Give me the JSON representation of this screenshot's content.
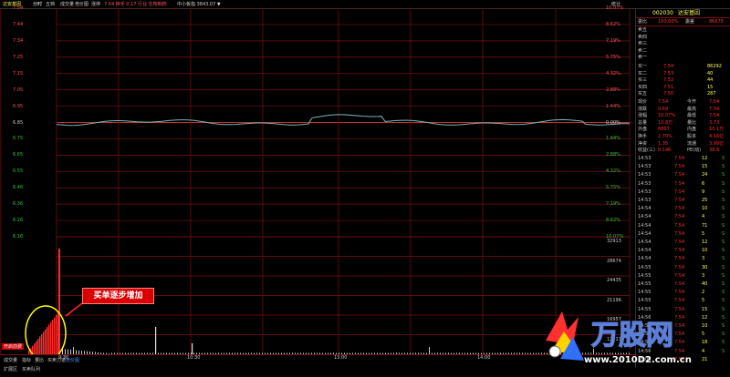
{
  "topbar": {
    "left_title": "达安基因",
    "tabs": [
      "分时",
      "五档",
      "成交量",
      "竞价图",
      "涨停"
    ],
    "status": "7.54 换手 0.17 行业 生物制药",
    "index_info": "中小板指 3843.07 ▼",
    "right_label": "统计"
  },
  "stock": {
    "code": "002030",
    "name": "达安基因"
  },
  "order_book": {
    "header": [
      {
        "label": "委比",
        "value": "100.00%",
        "label2": "委差",
        "value2": "86678"
      }
    ],
    "sells": [
      {
        "label": "卖五",
        "price": "",
        "vol": ""
      },
      {
        "label": "卖四",
        "price": "",
        "vol": ""
      },
      {
        "label": "卖三",
        "price": "",
        "vol": ""
      },
      {
        "label": "卖二",
        "price": "",
        "vol": ""
      },
      {
        "label": "卖一",
        "price": "",
        "vol": ""
      }
    ],
    "buys": [
      {
        "label": "买一",
        "price": "7.54",
        "vol": "86292"
      },
      {
        "label": "买二",
        "price": "7.53",
        "vol": "40"
      },
      {
        "label": "买三",
        "price": "7.52",
        "vol": "44"
      },
      {
        "label": "买四",
        "price": "7.51",
        "vol": "15"
      },
      {
        "label": "买五",
        "price": "7.50",
        "vol": "287"
      }
    ]
  },
  "quote": [
    {
      "l1": "现价",
      "v1": "7.54",
      "l2": "今开",
      "v2": "7.54"
    },
    {
      "l1": "涨跌",
      "v1": "0.69",
      "l2": "最高",
      "v2": "7.54"
    },
    {
      "l1": "涨幅",
      "v1": "10.07%",
      "l2": "最低",
      "v2": "7.54"
    },
    {
      "l1": "总量",
      "v1": "10.8万",
      "l2": "量比",
      "v2": "3.73"
    },
    {
      "l1": "外盘",
      "v1": "6867",
      "l2": "内盘",
      "v2": "10.1万"
    },
    {
      "l1": "换手",
      "v1": "2.70%",
      "l2": "股本",
      "v2": "4.16亿"
    },
    {
      "l1": "净资",
      "v1": "1.35",
      "l2": "流通",
      "v2": "3.99亿"
    },
    {
      "l1": "收益(三)",
      "v1": "0.146",
      "l2": "PE(动)",
      "v2": "38.6"
    }
  ],
  "trades": [
    {
      "time": "14:53",
      "price": "7.54",
      "vol": "12",
      "dir": "S"
    },
    {
      "time": "14:53",
      "price": "7.54",
      "vol": "15",
      "dir": "S"
    },
    {
      "time": "14:53",
      "price": "7.54",
      "vol": "24",
      "dir": "S"
    },
    {
      "time": "14:53",
      "price": "7.54",
      "vol": "6",
      "dir": "S"
    },
    {
      "time": "14:53",
      "price": "7.54",
      "vol": "9",
      "dir": "S"
    },
    {
      "time": "14:53",
      "price": "7.54",
      "vol": "25",
      "dir": "S"
    },
    {
      "time": "14:54",
      "price": "7.54",
      "vol": "10",
      "dir": "S"
    },
    {
      "time": "14:54",
      "price": "7.54",
      "vol": "4",
      "dir": "S"
    },
    {
      "time": "14:54",
      "price": "7.54",
      "vol": "71",
      "dir": "S"
    },
    {
      "time": "14:54",
      "price": "7.54",
      "vol": "5",
      "dir": "S"
    },
    {
      "time": "14:54",
      "price": "7.54",
      "vol": "12",
      "dir": "S"
    },
    {
      "time": "14:54",
      "price": "7.54",
      "vol": "10",
      "dir": "S"
    },
    {
      "time": "14:54",
      "price": "7.54",
      "vol": "3",
      "dir": "S"
    },
    {
      "time": "14:55",
      "price": "7.54",
      "vol": "30",
      "dir": "S"
    },
    {
      "time": "14:55",
      "price": "7.54",
      "vol": "3",
      "dir": "S"
    },
    {
      "time": "14:55",
      "price": "7.54",
      "vol": "40",
      "dir": "S"
    },
    {
      "time": "14:55",
      "price": "7.54",
      "vol": "2",
      "dir": "S"
    },
    {
      "time": "14:55",
      "price": "7.54",
      "vol": "5",
      "dir": "S"
    },
    {
      "time": "14:55",
      "price": "7.54",
      "vol": "15",
      "dir": "S"
    },
    {
      "time": "14:56",
      "price": "7.54",
      "vol": "12",
      "dir": "S"
    },
    {
      "time": "14:56",
      "price": "7.54",
      "vol": "10",
      "dir": "S"
    },
    {
      "time": "14:56",
      "price": "7.54",
      "vol": "5",
      "dir": "S"
    },
    {
      "time": "14:56",
      "price": "7.54",
      "vol": "18",
      "dir": "S"
    },
    {
      "time": "14:56",
      "price": "7.54",
      "vol": "4",
      "dir": "S"
    },
    {
      "time": "15:00",
      "price": "7.54",
      "vol": "21",
      "dir": ""
    }
  ],
  "left_ticks": [
    "7.54",
    "7.44",
    "7.34",
    "7.25",
    "7.15",
    "7.05",
    "6.95",
    "6.85",
    "6.75",
    "6.65",
    "6.55",
    "6.46",
    "6.36",
    "6.26",
    "6.16"
  ],
  "right_ticks": [
    "10.07%",
    "8.62%",
    "7.19%",
    "5.75%",
    "4.32%",
    "2.88%",
    "1.44%",
    "0.00%",
    "1.44%",
    "2.88%",
    "4.32%",
    "5.75%",
    "7.19%",
    "8.62%",
    "10.07%"
  ],
  "vol_ticks": [
    "32913",
    "28674",
    "24435",
    "21196",
    "16957",
    "12717"
  ],
  "time_ticks": [
    "9:30",
    "10:30",
    "13:00",
    "14:00"
  ],
  "callout": "买单逐步增加",
  "bottombar": {
    "row1": [
      "成交量",
      "指标",
      "量比",
      "买卖力道",
      "竞价图"
    ],
    "row2": [
      "扩展区",
      "买卖队列"
    ],
    "badge": "开启前费"
  },
  "watermark": {
    "brand": "万股网",
    "url": "www.2010D2.com.cn"
  },
  "colors": {
    "up": "#ff2a2a",
    "grid": "#7a1010",
    "price_line": "#7ab8b8",
    "avg_line": "#c8c8c8",
    "text_yellow": "#ffff54"
  }
}
